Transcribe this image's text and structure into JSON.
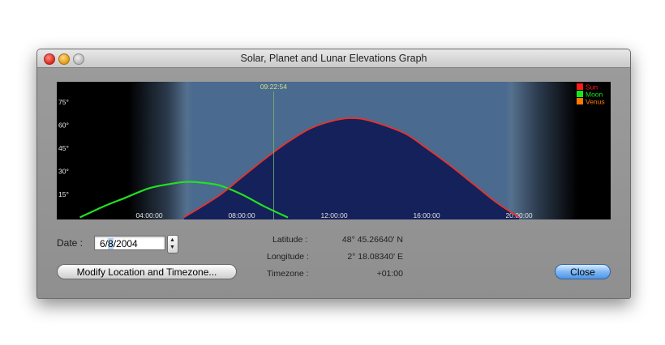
{
  "window": {
    "title": "Solar, Planet and Lunar Elevations Graph"
  },
  "graph": {
    "current_time": "09:22:54",
    "y_ticks": [
      "75°",
      "60°",
      "45°",
      "30°",
      "15°"
    ],
    "x_ticks": [
      "04:00:00",
      "08:00:00",
      "12:00:00",
      "16:00:00",
      "20:00:00"
    ],
    "legend": [
      {
        "name": "Sun",
        "color": "#ff1a1a"
      },
      {
        "name": "Moon",
        "color": "#18e818"
      },
      {
        "name": "Venus",
        "color": "#ff7a00"
      }
    ],
    "colors": {
      "night": "#000000",
      "twilight": "#55718f",
      "day": "#4a6a8f",
      "sun_fill": "#14215a",
      "sun_line": "#e8322b",
      "moon_line": "#22e022",
      "time_line": "#7ab870",
      "tick_text": "#e4e4e4"
    }
  },
  "chart_data": {
    "type": "line",
    "x_unit": "hour of day",
    "xlim": [
      0,
      24
    ],
    "ylim": [
      0,
      90
    ],
    "ylabel_ticks": [
      15,
      30,
      45,
      60,
      75
    ],
    "current_hour": 9.3817,
    "series": [
      {
        "name": "Sun",
        "x": [
          5.5,
          7,
          8,
          9,
          10,
          11,
          12,
          12.7,
          13.5,
          15,
          16,
          17,
          18,
          19,
          20
        ],
        "y": [
          0,
          14,
          26,
          38,
          49,
          58,
          63,
          64.5,
          63,
          55,
          45,
          34,
          22,
          10,
          0
        ]
      },
      {
        "name": "Moon",
        "x": [
          1,
          2,
          3,
          4,
          5,
          5.5,
          6,
          7,
          8,
          9,
          10
        ],
        "y": [
          0,
          7,
          13,
          19,
          22,
          23,
          23,
          21,
          15,
          7,
          0
        ]
      },
      {
        "name": "Venus",
        "x": [
          5.5,
          8,
          10,
          12,
          12.7,
          14,
          16,
          18,
          20
        ],
        "y": [
          0,
          26,
          49,
          63,
          64.5,
          62,
          45,
          22,
          0
        ]
      }
    ]
  },
  "form": {
    "date_label": "Date :",
    "date_month": "6/",
    "date_day": "8",
    "date_year": "/2004",
    "modify_button": "Modify Location and Timezone...",
    "close_button": "Close"
  },
  "location": {
    "latitude_label": "Latitude :",
    "latitude_value": "48°  45.26640' N",
    "longitude_label": "Longitude :",
    "longitude_value": "2°  18.08340' E",
    "timezone_label": "Timezone :",
    "timezone_value": "+01:00"
  }
}
